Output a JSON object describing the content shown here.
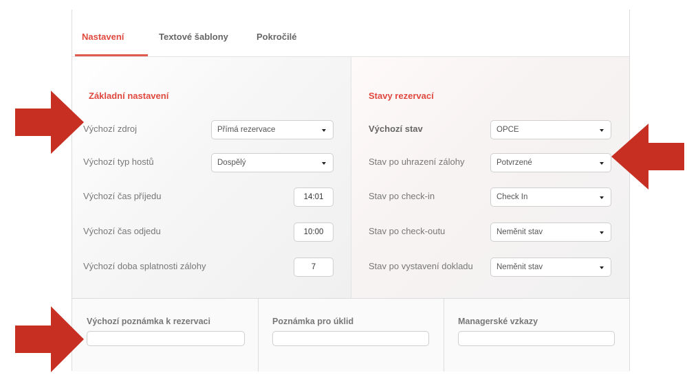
{
  "tabs": [
    {
      "label": "Nastavení",
      "active": true
    },
    {
      "label": "Textové šablony",
      "active": false
    },
    {
      "label": "Pokročilé",
      "active": false
    }
  ],
  "left": {
    "title": "Základní nastavení",
    "rows": [
      {
        "label": "Výchozí zdroj",
        "value": "Přímá rezervace"
      },
      {
        "label": "Výchozí typ hostů",
        "value": "Dospělý"
      },
      {
        "label": "Výchozí čas příjedu",
        "value": "14:01"
      },
      {
        "label": "Výchozí čas odjedu",
        "value": "10:00"
      },
      {
        "label": "Výchozí doba splatnosti zálohy",
        "value": "7"
      }
    ]
  },
  "right": {
    "title": "Stavy rezervací",
    "rows": [
      {
        "label": "Výchozí stav",
        "value": "OPCE"
      },
      {
        "label": "Stav po uhrazení zálohy",
        "value": "Potvrzené"
      },
      {
        "label": "Stav po check-in",
        "value": "Check In"
      },
      {
        "label": "Stav po check-outu",
        "value": "Neměnit stav"
      },
      {
        "label": "Stav po vystavení dokladu",
        "value": "Neměnit stav"
      }
    ]
  },
  "notes": [
    {
      "label": "Výchozí poznámka k rezervaci",
      "value": ""
    },
    {
      "label": "Poznámka pro úklid",
      "value": ""
    },
    {
      "label": "Managerské vzkazy",
      "value": ""
    }
  ],
  "colors": {
    "accent": "#e0483e",
    "arrow": "#c62f22"
  }
}
